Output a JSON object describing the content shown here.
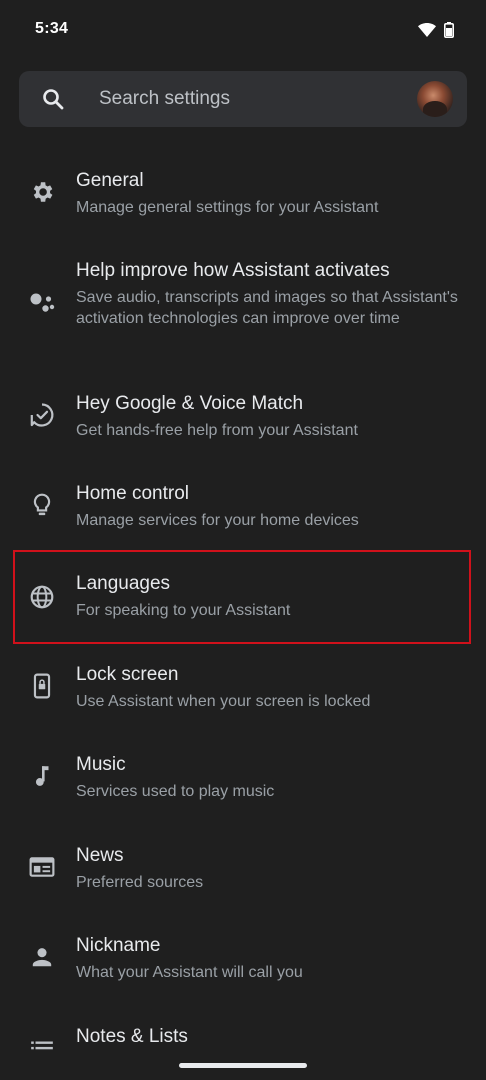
{
  "status_bar": {
    "time": "5:34",
    "icons": [
      "wifi-icon",
      "battery-icon"
    ]
  },
  "search": {
    "placeholder": "Search settings",
    "value": ""
  },
  "colors": {
    "background": "#1f1f1f",
    "search_bg": "#303134",
    "title_text": "#e8eaed",
    "subtitle_text": "#9aa0a6",
    "highlight": "#d0111b"
  },
  "settings": [
    {
      "icon": "gear-icon",
      "title": "General",
      "subtitle": "Manage general settings for your Assistant"
    },
    {
      "icon": "assistant-dots-icon",
      "title": "Help improve how Assistant activates",
      "subtitle": "Save audio, transcripts and images so that Assistant's activation technologies can improve over time"
    },
    {
      "icon": "voice-match-icon",
      "title": "Hey Google & Voice Match",
      "subtitle": "Get hands-free help from your Assistant"
    },
    {
      "icon": "lightbulb-icon",
      "title": "Home control",
      "subtitle": "Manage services for your home devices"
    },
    {
      "icon": "globe-icon",
      "title": "Languages",
      "subtitle": "For speaking to your Assistant",
      "highlighted": true
    },
    {
      "icon": "lock-screen-icon",
      "title": "Lock screen",
      "subtitle": "Use Assistant when your screen is locked"
    },
    {
      "icon": "music-note-icon",
      "title": "Music",
      "subtitle": "Services used to play music"
    },
    {
      "icon": "news-icon",
      "title": "News",
      "subtitle": "Preferred sources"
    },
    {
      "icon": "person-icon",
      "title": "Nickname",
      "subtitle": "What your Assistant will call you"
    },
    {
      "icon": "list-icon",
      "title": "Notes & Lists",
      "subtitle": ""
    }
  ]
}
